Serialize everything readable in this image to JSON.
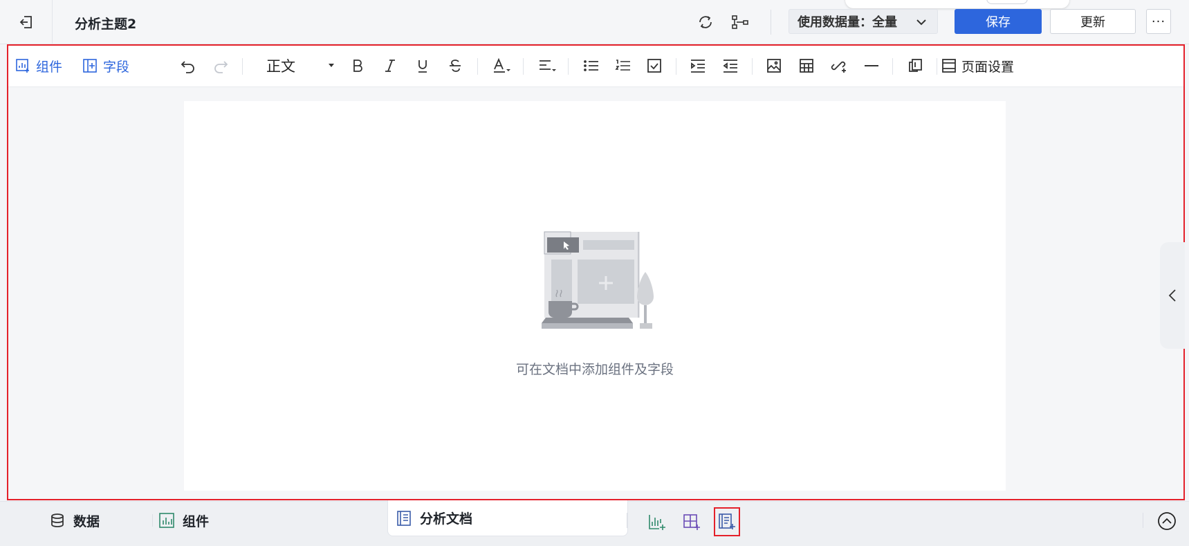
{
  "header": {
    "title": "分析主题2",
    "data_amount_label": "使用数据量：全量",
    "save_label": "保存",
    "update_label": "更新",
    "more_label": "···"
  },
  "toolbar": {
    "component_label": "组件",
    "field_label": "字段",
    "paragraph_style": "正文",
    "page_settings_label": "页面设置"
  },
  "document": {
    "empty_text": "可在文档中添加组件及字段"
  },
  "bottom": {
    "data_tab": "数据",
    "component_tab": "组件",
    "doc_tab": "分析文档"
  },
  "colors": {
    "accent": "#2d66dd",
    "highlight": "#e4202a"
  }
}
